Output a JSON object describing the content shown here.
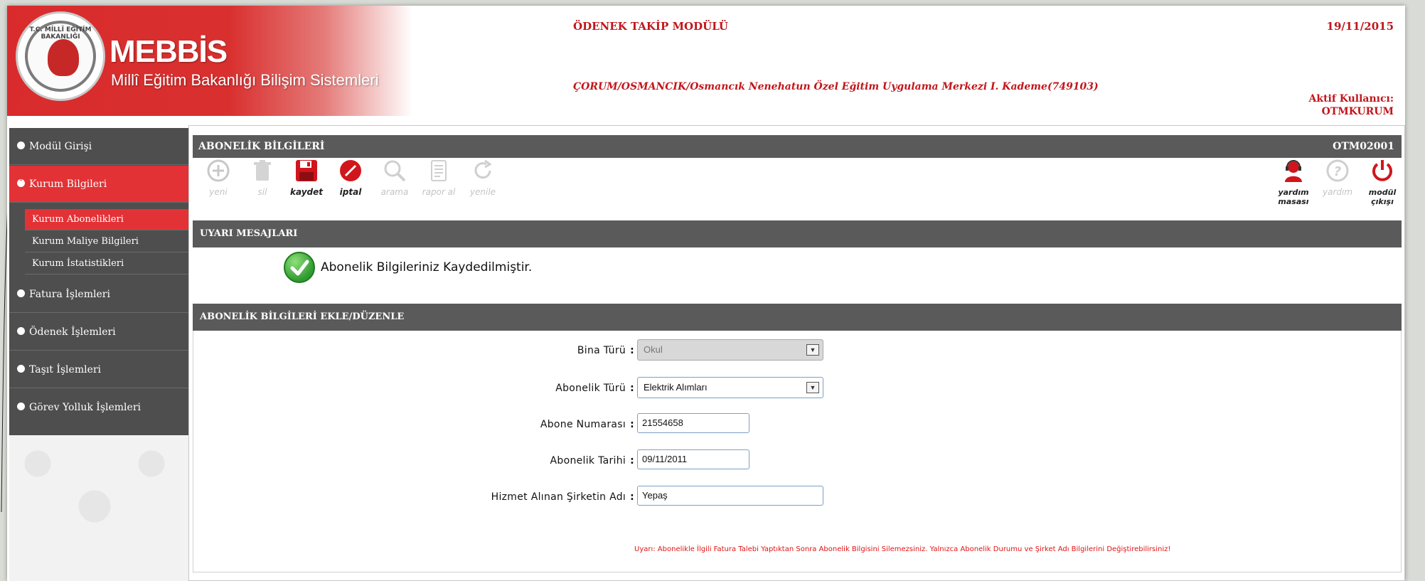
{
  "header": {
    "brand_title": "MEBBİS",
    "brand_subtitle": "Millî Eğitim Bakanlığı Bilişim Sistemleri",
    "logo_text": "T.C. MİLLÎ EĞİTİM BAKANLIĞI",
    "module_title": "ÖDENEK TAKİP MODÜLÜ",
    "date": "19/11/2015",
    "institution": "ÇORUM/OSMANCIK/Osmancık Nenehatun Özel Eğitim Uygulama Merkezi I. Kademe(749103)",
    "active_user_label": "Aktif Kullanıcı:",
    "active_user": "OTMKURUM"
  },
  "sidebar": {
    "items": [
      {
        "label": "Modül Girişi",
        "icon": "circle-bullet-icon"
      },
      {
        "label": "Kurum Bilgileri",
        "icon": "circle-bullet-icon"
      },
      {
        "label": "Fatura İşlemleri",
        "icon": "circle-bullet-icon"
      },
      {
        "label": "Ödenek İşlemleri",
        "icon": "circle-bullet-icon"
      },
      {
        "label": "Taşıt İşlemleri",
        "icon": "circle-bullet-icon"
      },
      {
        "label": "Görev Yolluk İşlemleri",
        "icon": "circle-bullet-icon"
      }
    ],
    "sub_items": [
      {
        "label": "Kurum Abonelikleri"
      },
      {
        "label": "Kurum Maliye Bilgileri"
      },
      {
        "label": "Kurum İstatistikleri"
      }
    ]
  },
  "panel": {
    "title": "ABONELİK BİLGİLERİ",
    "code": "OTM02001"
  },
  "toolbar": {
    "new": "yeni",
    "delete": "sil",
    "save": "kaydet",
    "cancel": "iptal",
    "search": "arama",
    "report": "rapor al",
    "refresh": "yenile",
    "help_desk": "yardım masası",
    "help": "yardım",
    "exit": "modül çıkışı"
  },
  "warnings": {
    "title": "UYARI MESAJLARI",
    "message": "Abonelik Bilgileriniz Kaydedilmiştir."
  },
  "form": {
    "title": "ABONELİK BİLGİLERİ EKLE/DÜZENLE",
    "building_type_label": "Bina Türü",
    "building_type_value": "Okul",
    "subscription_type_label": "Abonelik Türü",
    "subscription_type_value": "Elektrik Alımları",
    "subscriber_number_label": "Abone Numarası",
    "subscriber_number_value": "21554658",
    "subscription_date_label": "Abonelik Tarihi",
    "subscription_date_value": "09/11/2011",
    "company_name_label": "Hizmet Alınan Şirketin Adı",
    "company_name_value": "Yepaş",
    "colon": ":",
    "notice": "Uyarı: Abonelikle İlgili Fatura Talebi Yaptıktan Sonra Abonelik Bilgisini Silemezsiniz. Yalnızca Abonelik Durumu ve Şirket Adı Bilgilerini Değiştirebilirsiniz!"
  },
  "colors": {
    "brand_red": "#d92b2c",
    "text_red": "#c1161b",
    "sidebar_gray": "#4e4e4e",
    "active_red": "#e23236",
    "bar_gray": "#5a5a5a",
    "success_green": "#2f9a2f",
    "notice_red": "#e01414"
  }
}
